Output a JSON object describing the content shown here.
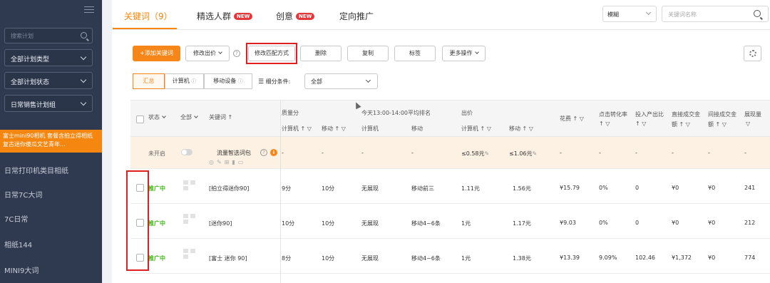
{
  "sidebar": {
    "search_placeholder": "搜索计划",
    "filters": [
      "全部计划类型",
      "全部计划状态",
      "日常销售计划组"
    ],
    "active_item": "富士mini90相机 套餐含拍立得相纸 复古迷你傻瓜文艺青年...",
    "items": [
      "日常打印机类目相纸",
      "日常7C大词",
      "7C日常",
      "相纸144",
      "MINI9大词"
    ]
  },
  "tabs": [
    {
      "label": "关键词（9）",
      "new": false
    },
    {
      "label": "精选人群",
      "new": true
    },
    {
      "label": "创意",
      "new": true
    },
    {
      "label": "定向推广",
      "new": false
    }
  ],
  "new_badge": "NEW",
  "top_bar": {
    "match_select": "模糊",
    "search_placeholder": "关键词名称"
  },
  "toolbar": {
    "add_keyword": "+添加关键词",
    "modify_bid": "修改出价",
    "help": "?",
    "modify_match": "修改匹配方式",
    "delete": "删除",
    "copy": "复制",
    "tag": "标签",
    "more": "更多操作"
  },
  "view_tabs": {
    "summary": "汇总",
    "computer": "计算机",
    "mobile": "移动设备"
  },
  "filter": {
    "label": "细分条件:",
    "value": "全部"
  },
  "table": {
    "headers": {
      "status": "状态",
      "all": "全部",
      "keyword": "关键词 ↑",
      "quality": "质量分",
      "quality_pc": "计算机 ↑ ▽",
      "quality_mobile": "移动 ↑ ▽",
      "rank": "今天13:00-14:00平均排名",
      "rank_pc": "计算机",
      "rank_mobile": "移动",
      "bid": "出价",
      "bid_pc": "计算机 ↑ ▽",
      "bid_mobile": "移动 ↑ ▽",
      "cost": "花费 ↑ ▽",
      "cvr_1": "点击转化率",
      "cvr_2": "↑ ▽",
      "roi_1": "投入产出比",
      "roi_2": "↑ ▽",
      "direct_1": "直接成交金",
      "direct_2": "额 ↑ ▽",
      "indirect_1": "间接成交金",
      "indirect_2": "额 ↑ ▽",
      "impressions_1": "展现量",
      "impressions_2": "▽"
    },
    "promo_row": {
      "status": "未开启",
      "name": "流量智选词包",
      "quality_pc": "-",
      "quality_mobile": "-",
      "rank_pc": "-",
      "rank_mobile": "-",
      "bid_pc": "≤0.58元",
      "bid_mobile": "≤1.06元",
      "cost": "-",
      "cvr": "-",
      "roi": "-",
      "direct": "-",
      "indirect": "-",
      "impressions": "-"
    },
    "rows": [
      {
        "status": "推广中",
        "keyword": "[拍立得迷你90]",
        "quality_pc": "9分",
        "quality_mobile": "10分",
        "rank_pc": "无展现",
        "rank_mobile": "移动前三",
        "bid_pc": "1.11元",
        "bid_mobile": "1.56元",
        "cost": "¥15.79",
        "cvr": "0%",
        "roi": "0",
        "direct": "¥0",
        "indirect": "¥0",
        "impressions": "241"
      },
      {
        "status": "推广中",
        "keyword": "[迷你90]",
        "quality_pc": "10分",
        "quality_mobile": "10分",
        "rank_pc": "无展现",
        "rank_mobile": "移动4~6条",
        "bid_pc": "1元",
        "bid_mobile": "1.17元",
        "cost": "¥9.03",
        "cvr": "0%",
        "roi": "0",
        "direct": "¥0",
        "indirect": "¥0",
        "impressions": "212"
      },
      {
        "status": "推广中",
        "keyword": "[富士 迷你 90]",
        "quality_pc": "8分",
        "quality_mobile": "10分",
        "rank_pc": "无展现",
        "rank_mobile": "移动4~6条",
        "bid_pc": "1元",
        "bid_mobile": "1.38元",
        "cost": "¥13.39",
        "cvr": "9.09%",
        "roi": "102.46",
        "direct": "¥1,372",
        "indirect": "¥0",
        "impressions": "774"
      }
    ]
  },
  "colors": {
    "accent": "#f7861a",
    "sidebar_bg": "#2f3a50",
    "status_on": "#3fb618",
    "highlight_box": "#e02020"
  }
}
